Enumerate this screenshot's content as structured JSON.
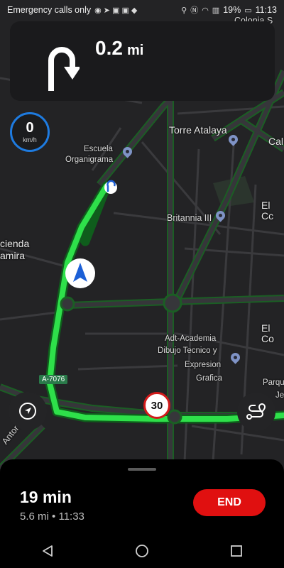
{
  "status_bar": {
    "carrier": "Emergency calls only",
    "battery": "19%",
    "time": "11:13"
  },
  "instruction": {
    "distance_value": "0.2",
    "distance_unit": "mi",
    "maneuver_icon": "u-turn-left-icon"
  },
  "speedometer": {
    "value": "0",
    "unit": "km/h"
  },
  "map": {
    "labels": {
      "colonia": "Colonia S",
      "torre": "Torre Atalaya",
      "escuela_1": "Escuela",
      "escuela_2": "Organigrama",
      "cal": "Cal",
      "elco_1": "El Cc",
      "britannia": "Britannia III",
      "hacienda_1": "cienda",
      "hacienda_2": "amira",
      "elco_2": "El Co",
      "adt_1": "Adt-Academia",
      "adt_2": "Dibujo Tecnico y",
      "adt_3": "Expresion",
      "adt_4": "Grafica",
      "parque_1": "Parqu",
      "parque_2": "Je",
      "antonio": "Antonio G",
      "road_number": "A-7076"
    },
    "speed_limit": "30"
  },
  "trip": {
    "duration": "19 min",
    "distance": "5.6 mi",
    "separator": "•",
    "arrival": "11:33",
    "end_label": "END"
  },
  "colors": {
    "route": "#2ee04a",
    "end_button": "#e01010",
    "speedo_ring": "#1e7be0",
    "position_arrow": "#1c5fd6"
  }
}
